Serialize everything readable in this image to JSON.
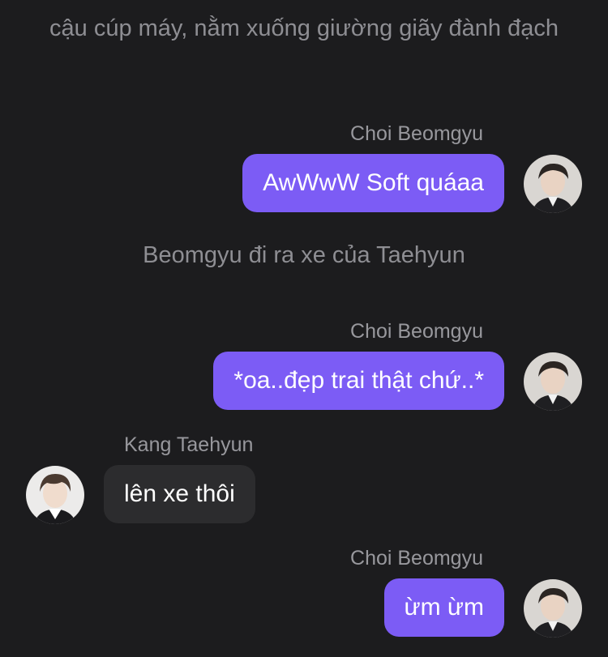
{
  "narration": [
    "cậu cúp máy, nằm xuống giường giãy đành đạch",
    "Beomgyu đi ra xe của Taehyun"
  ],
  "messages": [
    {
      "sender": "Choi Beomgyu",
      "text": "AwWwW Soft quáaa",
      "side": "right",
      "avatar": "beomgyu-avatar"
    },
    {
      "sender": "Choi Beomgyu",
      "text": "*oa..đẹp trai thật chứ..*",
      "side": "right",
      "avatar": "beomgyu-avatar"
    },
    {
      "sender": "Kang Taehyun",
      "text": "lên xe thôi",
      "side": "left",
      "avatar": "taehyun-avatar"
    },
    {
      "sender": "Choi Beomgyu",
      "text": "ừm ừm",
      "side": "right",
      "avatar": "beomgyu-avatar"
    }
  ],
  "colors": {
    "background": "#1c1c1e",
    "outgoing_bubble": "#7c5cf5",
    "incoming_bubble": "#2c2c2e",
    "narration_text": "#8e8e93",
    "sender_text": "#98989d"
  }
}
